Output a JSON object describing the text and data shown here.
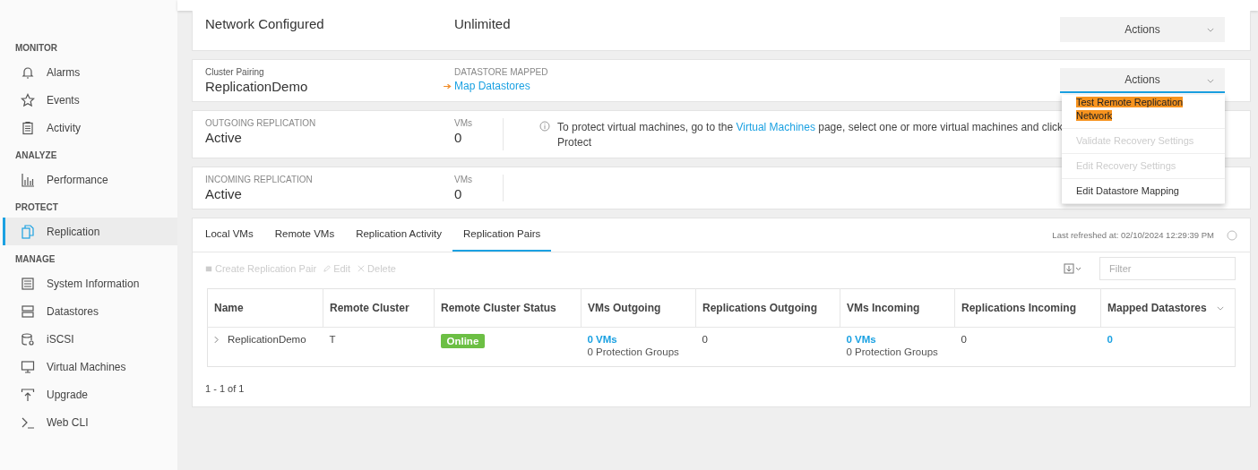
{
  "sidebar": {
    "sections": [
      {
        "heading": "MONITOR",
        "items": [
          {
            "label": "Alarms",
            "selected": false
          },
          {
            "label": "Events",
            "selected": false
          },
          {
            "label": "Activity",
            "selected": false
          }
        ]
      },
      {
        "heading": "ANALYZE",
        "items": [
          {
            "label": "Performance",
            "selected": false
          }
        ]
      },
      {
        "heading": "PROTECT",
        "items": [
          {
            "label": "Replication",
            "selected": true
          }
        ]
      },
      {
        "heading": "MANAGE",
        "items": [
          {
            "label": "System Information",
            "selected": false
          },
          {
            "label": "Datastores",
            "selected": false
          },
          {
            "label": "iSCSI",
            "selected": false
          },
          {
            "label": "Virtual Machines",
            "selected": false
          },
          {
            "label": "Upgrade",
            "selected": false
          },
          {
            "label": "Web CLI",
            "selected": false
          }
        ]
      }
    ]
  },
  "cards": [
    {
      "fields": [
        {
          "kind": "value",
          "value": "Network Configured"
        },
        {
          "kind": "value",
          "value": "Unlimited"
        }
      ],
      "actions": "Actions"
    },
    {
      "fields": [
        {
          "kind": "value",
          "label": "Cluster Pairing",
          "value": "ReplicationDemo"
        },
        {
          "kind": "link",
          "label": "DATASTORE MAPPED",
          "value": "Map Datastores"
        }
      ],
      "actions": "Actions",
      "menu_open": true
    },
    {
      "fields": [
        {
          "kind": "value",
          "label": "OUTGOING REPLICATION",
          "value": "Active"
        },
        {
          "kind": "count",
          "label": "VMs",
          "value": "0"
        }
      ],
      "note": {
        "before": "To protect virtual machines, go to the",
        "link": "Virtual Machines",
        "after": "page, select one or more virtual machines and click Protect"
      }
    },
    {
      "fields": [
        {
          "kind": "value",
          "label": "INCOMING REPLICATION",
          "value": "Active"
        },
        {
          "kind": "count",
          "label": "VMs",
          "value": "0"
        }
      ]
    }
  ],
  "actions_menu": [
    {
      "label": "Test Remote Replication Network",
      "disabled": false,
      "highlighted": true
    },
    {
      "label": "Validate Recovery Settings",
      "disabled": true,
      "highlighted": false
    },
    {
      "label": "Edit Recovery Settings",
      "disabled": true,
      "highlighted": false
    },
    {
      "label": "Edit Datastore Mapping",
      "disabled": false,
      "highlighted": false
    }
  ],
  "tabs": [
    {
      "label": "Local VMs",
      "selected": false
    },
    {
      "label": "Remote VMs",
      "selected": false
    },
    {
      "label": "Replication Activity",
      "selected": false
    },
    {
      "label": "Replication Pairs",
      "selected": true
    }
  ],
  "last_refreshed": "Last refreshed at: 02/10/2024 12:29:39 PM",
  "toolbar": [
    {
      "kind": "create",
      "label": "Create Replication Pair",
      "disabled": true
    },
    {
      "kind": "edit",
      "label": "Edit",
      "disabled": true
    },
    {
      "kind": "delete",
      "label": "Delete",
      "disabled": true
    }
  ],
  "filter": {
    "placeholder": "Filter"
  },
  "table": {
    "columns": [
      "Name",
      "Remote Cluster",
      "Remote Cluster Status",
      "VMs Outgoing",
      "Replications Outgoing",
      "VMs Incoming",
      "Replications Incoming",
      "Mapped Datastores"
    ],
    "rows": [
      {
        "name": "ReplicationDemo",
        "remote_cluster": "T",
        "status": {
          "label": "Online",
          "color": "#6cbf44"
        },
        "vms_outgoing": {
          "link": "0 VMs",
          "sub": "0 Protection Groups"
        },
        "replications_outgoing": "0",
        "vms_incoming": {
          "link": "0 VMs",
          "sub": "0 Protection Groups"
        },
        "replications_incoming": "0",
        "mapped_datastores": "0"
      }
    ]
  },
  "pagination": "1 - 1 of 1"
}
